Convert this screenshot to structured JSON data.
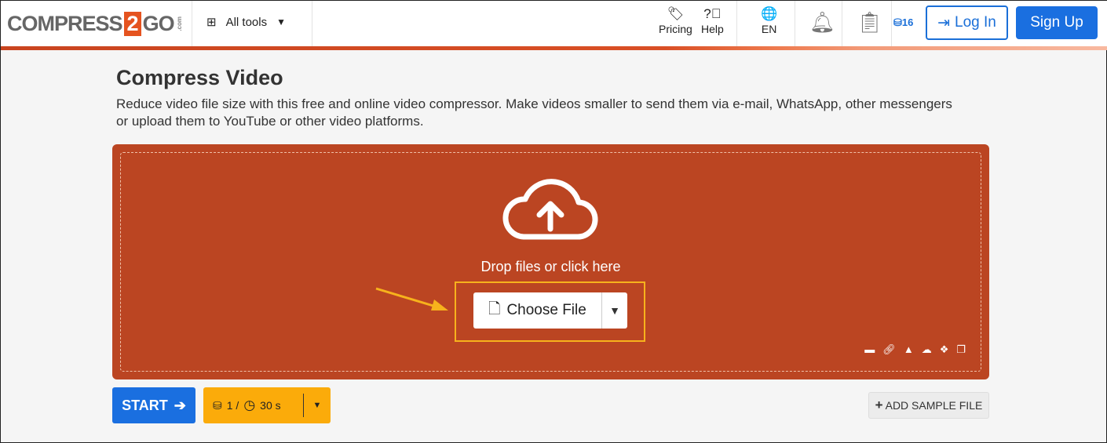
{
  "header": {
    "logo": {
      "left": "COMPRESS",
      "num": "2",
      "right": "GO",
      "tld": ".com"
    },
    "all_tools": "All tools",
    "pricing": "Pricing",
    "help": "Help",
    "language": "EN",
    "credits": "16",
    "login": "Log In",
    "signup": "Sign Up"
  },
  "main": {
    "title": "Compress Video",
    "description": "Reduce video file size with this free and online video compressor. Make videos smaller to send them via e-mail, WhatsApp, other messengers or upload them to YouTube or other video platforms.",
    "drop_text": "Drop files or click here",
    "choose_file": "Choose File",
    "start": "START",
    "cost_credits": "1 /",
    "cost_time": "30 s",
    "add_sample": "ADD SAMPLE FILE"
  },
  "colors": {
    "accent": "#bb4522",
    "primary": "#1a6fe0",
    "highlight": "#f7b21c",
    "cost_bg": "#fbab0a"
  }
}
